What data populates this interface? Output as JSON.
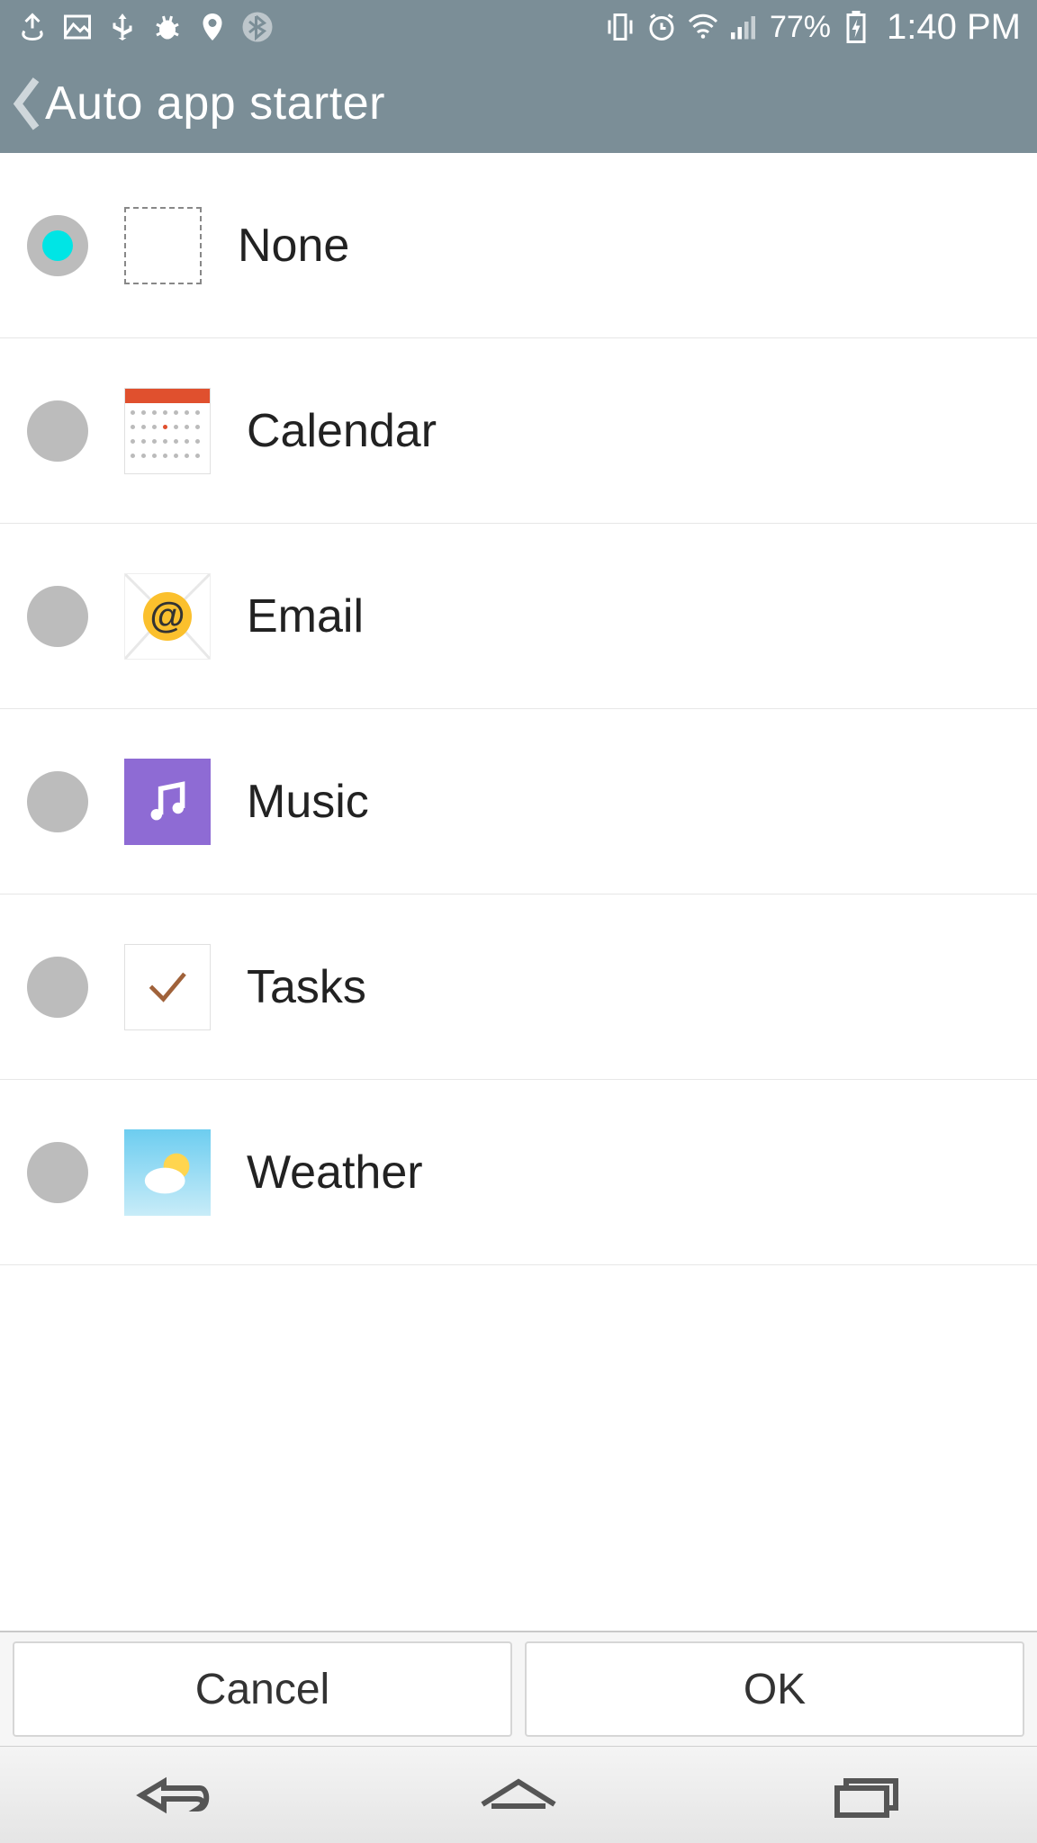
{
  "statusbar": {
    "battery_pct": "77%",
    "time": "1:40 PM"
  },
  "header": {
    "title": "Auto app starter"
  },
  "rows": [
    {
      "label": "None",
      "icon": "none",
      "selected": true
    },
    {
      "label": "Calendar",
      "icon": "calendar",
      "selected": false
    },
    {
      "label": "Email",
      "icon": "email",
      "selected": false
    },
    {
      "label": "Music",
      "icon": "music",
      "selected": false
    },
    {
      "label": "Tasks",
      "icon": "tasks",
      "selected": false
    },
    {
      "label": "Weather",
      "icon": "weather",
      "selected": false
    }
  ],
  "buttons": {
    "cancel": "Cancel",
    "ok": "OK"
  }
}
